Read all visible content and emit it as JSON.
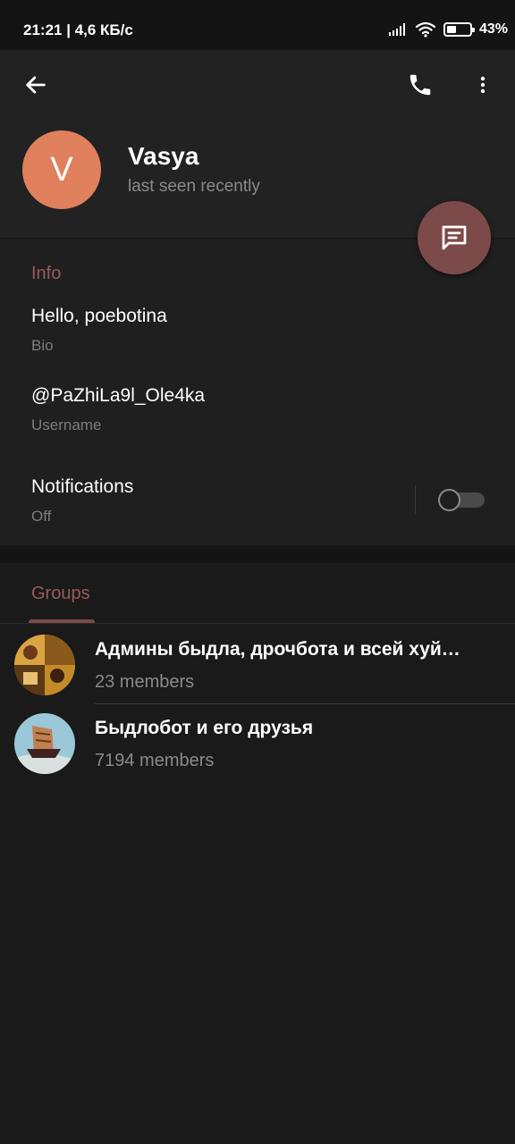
{
  "statusbar": {
    "time": "21:21",
    "speed": "4,6 КБ/с",
    "battery_percent": "43%",
    "battery_level": 0.43,
    "icons": [
      "signal-icon",
      "wifi-icon",
      "battery-icon"
    ]
  },
  "toolbar": {
    "icons": [
      "back-arrow-icon",
      "phone-icon",
      "more-vertical-icon"
    ]
  },
  "profile": {
    "avatar_letter": "V",
    "avatar_color": "#e0805c",
    "name": "Vasya",
    "status": "last seen recently"
  },
  "fab": {
    "icon": "message-icon",
    "color": "#7d4a4a"
  },
  "info": {
    "section_title": "Info",
    "bio_value": "Hello, poebotina",
    "bio_label": "Bio",
    "username_value": "@PaZhiLa9l_Ole4ka",
    "username_label": "Username",
    "notifications_title": "Notifications",
    "notifications_value": "Off",
    "notifications_enabled": false
  },
  "groups": {
    "section_title": "Groups",
    "items": [
      {
        "name": "Админы быдла, дрочбота и всей хуй…",
        "members": "23 members"
      },
      {
        "name": "Быдлобот и его друзья",
        "members": "7194 members"
      }
    ]
  },
  "colors": {
    "accent": "#9a5a5a",
    "background": "#1a1a1a",
    "header": "#222222"
  }
}
